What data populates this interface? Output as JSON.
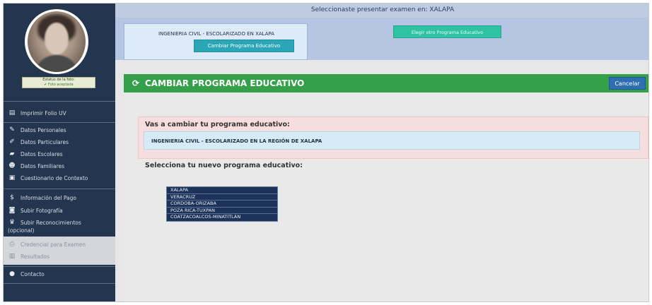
{
  "banner": {
    "text": "Seleccionaste presentar examen en: XALAPA"
  },
  "photo_status": {
    "line1": "Estatus de la foto:",
    "line2": "✔ Foto aceptada"
  },
  "sidebar": {
    "items": [
      {
        "label": "Imprimir Folio UV",
        "icon": "document-icon"
      },
      {
        "label": "Datos Personales",
        "icon": "pencil-icon"
      },
      {
        "label": "Datos Particulares",
        "icon": "edit-icon"
      },
      {
        "label": "Datos Escolares",
        "icon": "graduation-cap-icon"
      },
      {
        "label": "Datos Familiares",
        "icon": "users-icon"
      },
      {
        "label": "Cuestionario de Contexto",
        "icon": "chat-icon"
      },
      {
        "label": "Información del Pago",
        "icon": "dollar-icon"
      },
      {
        "label": "Subir Fotografía",
        "icon": "camera-icon"
      },
      {
        "label": "Subir Reconocimientos",
        "label2": "(opcional)",
        "icon": "trophy-icon"
      },
      {
        "label": "Credencial para Examen",
        "icon": "printer-icon",
        "disabled": true
      },
      {
        "label": "Resultados",
        "icon": "chart-icon",
        "disabled": true
      },
      {
        "label": "Contacto",
        "icon": "speech-icon"
      }
    ]
  },
  "current_program": {
    "text": "INGENIERIA CIVIL - ESCOLARIZADO EN XALAPA",
    "change_button": "Cambiar Programa Educativo"
  },
  "other_program_button": "Elegir otro Programa Educativo",
  "section": {
    "title": "CAMBIAR PROGRAMA EDUCATIVO",
    "cancel_button": "Cancelar"
  },
  "notice": {
    "title": "Vas a cambiar tu programa educativo:",
    "program": "INGENIERIA CIVIL - ESCOLARIZADO EN LA REGIÓN DE XALAPA"
  },
  "select_title": "Selecciona tu nuevo programa educativo:",
  "regions": [
    "XALAPA",
    "VERACRUZ",
    "CORDOBA-ORIZABA",
    "POZA RICA-TUXPAN",
    "COATZACOALCOS-MINATITLÁN"
  ],
  "colors": {
    "sidebar": "#24364f",
    "header_green": "#35a04a",
    "button_teal": "#2aa6b6",
    "button_cancel": "#2f6fb1",
    "list_bg": "#1d3258"
  }
}
